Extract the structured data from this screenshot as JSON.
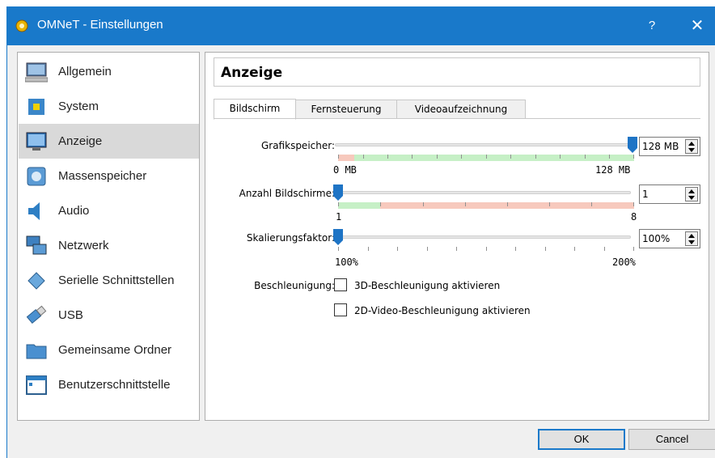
{
  "window": {
    "title": "OMNeT - Einstellungen",
    "help_label": "?",
    "close_label": "✕"
  },
  "sidebar": {
    "items": [
      {
        "label": "Allgemein",
        "icon": "monitor-icon"
      },
      {
        "label": "System",
        "icon": "chip-icon"
      },
      {
        "label": "Anzeige",
        "icon": "display-icon",
        "active": true
      },
      {
        "label": "Massenspeicher",
        "icon": "disk-icon"
      },
      {
        "label": "Audio",
        "icon": "speaker-icon"
      },
      {
        "label": "Netzwerk",
        "icon": "network-icon"
      },
      {
        "label": "Serielle Schnittstellen",
        "icon": "serial-icon"
      },
      {
        "label": "USB",
        "icon": "usb-icon"
      },
      {
        "label": "Gemeinsame Ordner",
        "icon": "folder-icon"
      },
      {
        "label": "Benutzerschnittstelle",
        "icon": "ui-window-icon"
      }
    ]
  },
  "panel": {
    "title": "Anzeige",
    "tabs": [
      "Bildschirm",
      "Fernsteuerung",
      "Videoaufzeichnung"
    ],
    "active_tab": 0,
    "grafikspeicher": {
      "label": "Grafikspeicher:",
      "value": "128 MB",
      "min_label": "0 MB",
      "max_label": "128 MB",
      "fraction": 1.0
    },
    "bildschirme": {
      "label": "Anzahl Bildschirme:",
      "value": "1",
      "min_label": "1",
      "max_label": "8",
      "fraction": 0.0
    },
    "skalierung": {
      "label": "Skalierungsfaktor:",
      "value": "100%",
      "min_label": "100%",
      "max_label": "200%",
      "fraction": 0.0
    },
    "beschleunigung": {
      "label": "Beschleunigung:",
      "opt3d": {
        "label": "3D-Beschleunigung aktivieren",
        "checked": false
      },
      "opt2d": {
        "label": "2D-Video-Beschleunigung aktivieren",
        "checked": false
      }
    }
  },
  "buttons": {
    "ok": "OK",
    "cancel": "Cancel"
  },
  "colors": {
    "titlebar": "#1979ca",
    "thumb": "#1e74c5",
    "scale_green": "#c6f0c6",
    "scale_red": "#f7c9bd"
  }
}
